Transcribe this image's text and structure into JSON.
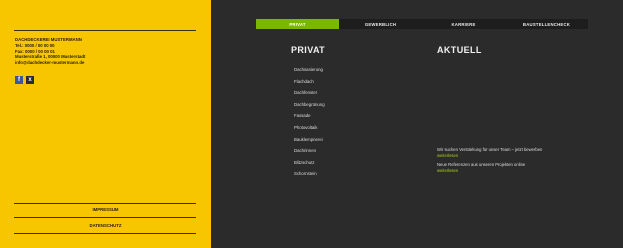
{
  "contact": {
    "lines": [
      "DACHDECKEREI MUSTERMANN",
      "Tel.: 0000 / 00 00 00",
      "Fax: 0000 / 00 00 01",
      "Musterstraße 1, 00000 Musterstadt",
      "info@dachdecker-mustermann.de"
    ]
  },
  "social": {
    "facebook": "f",
    "xing": "x"
  },
  "footer_links": {
    "impressum": "IMPRESSUM",
    "datenschutz": "DATENSCHUTZ"
  },
  "tabs": [
    "PRIVAT",
    "GEWERBLICH",
    "KARRIERE",
    "BAUSTELLENCHECK"
  ],
  "privat": {
    "heading": "PRIVAT",
    "items": [
      "Dachsanierung",
      "Flachdach",
      "Dachfenster",
      "Dachbegrünung",
      "Fassade",
      "Photovoltaik",
      "Bauklempnerei",
      "Dachrinnen",
      "Blitzschutz",
      "Schornstein"
    ]
  },
  "aktuell": {
    "heading": "AKTUELL",
    "news": [
      {
        "text": "Wir suchen Verstärkung für unser Team – jetzt bewerben",
        "link": "weiterlesen"
      },
      {
        "text": "Neue Referenzen aus unseren Projekten online",
        "link": "weiterlesen"
      }
    ]
  },
  "colors": {
    "yellow": "#f7c600",
    "green": "#7ab800",
    "dark": "#2b2b2b"
  }
}
